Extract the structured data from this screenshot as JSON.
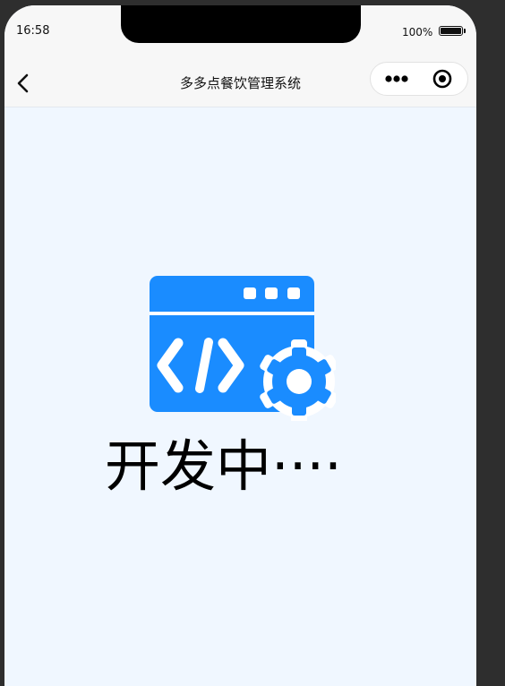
{
  "status_bar": {
    "time": "16:58",
    "battery_percent": "100%",
    "battery_level": 1.0
  },
  "nav": {
    "title": "多多点餐饮管理系统",
    "back_icon": "chevron-left-icon",
    "more_icon": "more-dots-icon",
    "close_icon": "target-circle-icon"
  },
  "main": {
    "illustration_icon": "code-window-gear-icon",
    "status_text": "开发中····"
  },
  "colors": {
    "accent": "#1a8cff",
    "background": "#f0f7ff",
    "frame": "#2e2e2e"
  }
}
